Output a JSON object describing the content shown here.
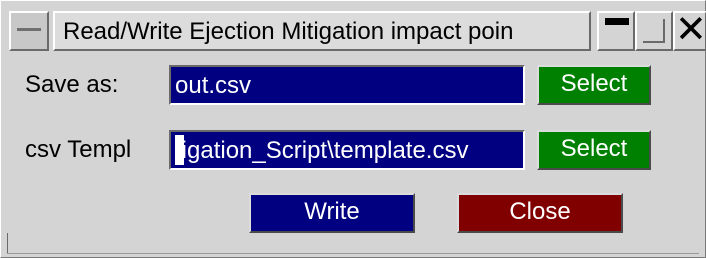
{
  "window": {
    "title": "Read/Write Ejection Mitigation impact poin"
  },
  "save_as": {
    "label": "Save as:",
    "value": "out.csv",
    "select_label": "Select"
  },
  "csv_template": {
    "label": "csv Templ",
    "value": "tigation_Script\\template.csv",
    "select_label": "Select"
  },
  "actions": {
    "write_label": "Write",
    "close_label": "Close"
  },
  "colors": {
    "field_bg": "#000080",
    "select_button": "#008000",
    "write_button": "#000080",
    "close_button": "#800000"
  }
}
